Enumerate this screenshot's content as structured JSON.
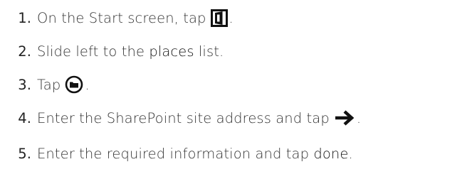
{
  "steps": [
    {
      "number": "1.",
      "text": "On the Start screen, tap",
      "icon": "office-tile-icon",
      "end": "."
    },
    {
      "number": "2.",
      "before": "Slide left to the",
      "emphasis": "places",
      "after": "list."
    },
    {
      "number": "3.",
      "text": "Tap",
      "icon": "add-place-icon",
      "end": "."
    },
    {
      "number": "4.",
      "text": "Enter the SharePoint site address and tap",
      "icon": "arrow-right-icon",
      "end": "."
    },
    {
      "number": "5.",
      "before": "Enter the required information and tap",
      "emphasis": "done",
      "end": "."
    }
  ]
}
